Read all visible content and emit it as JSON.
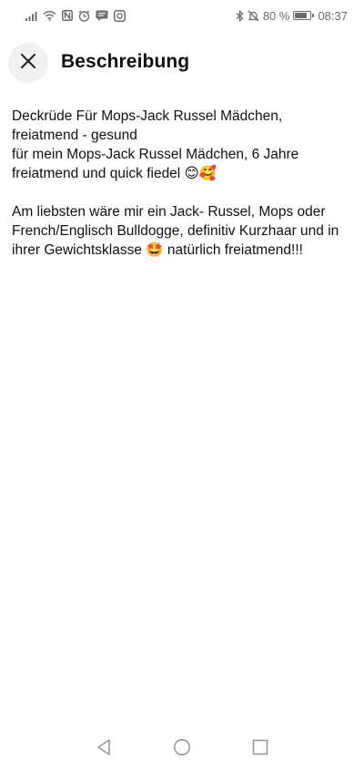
{
  "status_bar": {
    "battery_percent": "80 %",
    "battery_level": 0.8,
    "time": "08:37",
    "left_icons": [
      "signal-icon",
      "wifi-icon",
      "nfc-icon",
      "alarm-icon",
      "message-icon",
      "instagram-icon"
    ],
    "right_icons": [
      "bluetooth-icon",
      "mute-icon",
      "battery-icon"
    ]
  },
  "header": {
    "title": "Beschreibung",
    "close_icon": "close-icon"
  },
  "description": {
    "lines": [
      "Deckrüde Für Mops-Jack Russel Mädchen, freiatmend - gesund",
      "für mein Mops-Jack Russel Mädchen, 6 Jahre freiatmend und quick fiedel 😊🥰",
      "",
      "Am liebsten wäre mir ein Jack- Russel, Mops oder French/Englisch Bulldogge, definitiv Kurzhaar und in ihrer Gewichtsklasse 🤩 natürlich freiatmend!!!"
    ]
  },
  "nav_bar": {
    "buttons": [
      "back-icon",
      "home-icon",
      "recents-icon"
    ]
  },
  "colors": {
    "text": "#111111",
    "status": "#6b6b6b",
    "close_bg": "#f1f1f1",
    "nav": "#9a9a9a"
  }
}
